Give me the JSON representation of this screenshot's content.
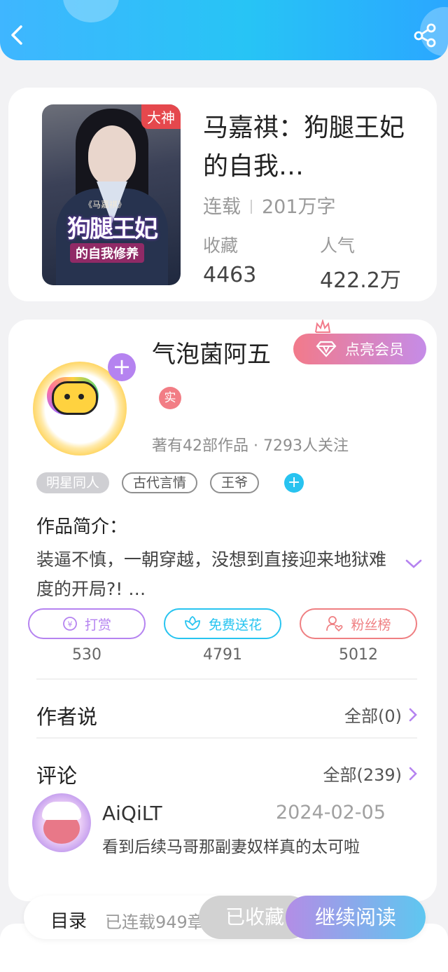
{
  "book": {
    "badge": "大神",
    "cover_subtitle": "《马嘉祺》",
    "cover_title": "狗腿王妃",
    "cover_title_2": "的自我修养",
    "title": "马嘉祺：狗腿王妃的自我…",
    "status": "连载",
    "word_count": "201万字",
    "favorites_label": "收藏",
    "favorites_value": "4463",
    "popularity_label": "人气",
    "popularity_value": "422.2万"
  },
  "author": {
    "name": "气泡菌阿五",
    "vip_button": "点亮会员",
    "verified_badge": "实",
    "stats": "著有42部作品 · 7293人关注"
  },
  "tags": [
    "明星同人",
    "古代言情",
    "王爷"
  ],
  "tag_add": "+",
  "intro": {
    "title": "作品简介：",
    "text": "装逼不慎，一朝穿越，没想到直接迎来地狱难度的开局?! …"
  },
  "actions": [
    {
      "label": "打赏",
      "count": "530",
      "color": "#b583f0"
    },
    {
      "label": "免费送花",
      "count": "4791",
      "color": "#27c4f0"
    },
    {
      "label": "粉丝榜",
      "count": "5012",
      "color": "#ef7f82"
    }
  ],
  "author_says": {
    "title": "作者说",
    "link": "全部(0)"
  },
  "comments": {
    "title": "评论",
    "link": "全部(239)",
    "first": {
      "user": "AiQiLT",
      "date": "2024-02-05",
      "text": "看到后续马哥那副妻奴样真的太可啦"
    }
  },
  "bottom": {
    "catalog": "目录",
    "serial": "已连载949章",
    "favorited": "已收藏",
    "continue": "继续阅读"
  },
  "colors": {
    "header": "#27c4f5",
    "accent_purple": "#b583f0",
    "accent_pink": "#f27a8a"
  }
}
